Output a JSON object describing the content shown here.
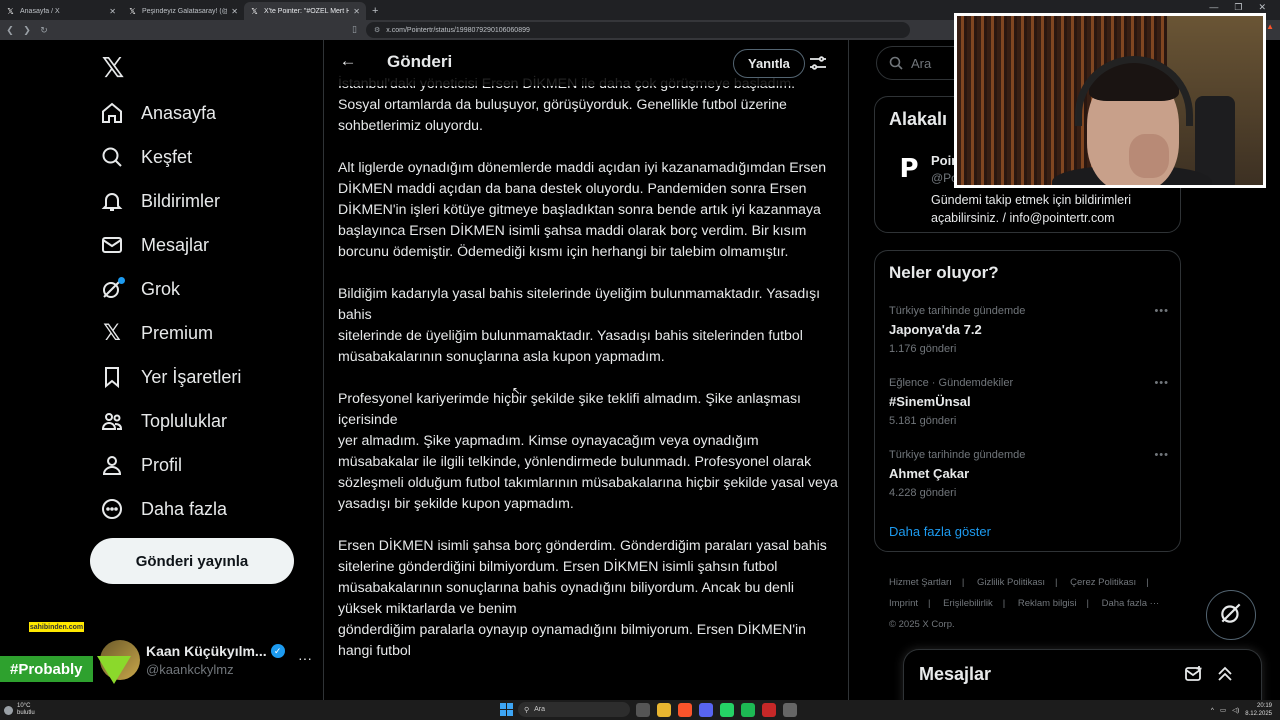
{
  "browser": {
    "tabs": [
      {
        "title": "Anasayfa / X",
        "active": false
      },
      {
        "title": "Peşindeyiz Galatasaray! (@Pesindey...",
        "active": false
      },
      {
        "title": "X'te Pointer: \"#ÖZEL Mert Hakan...",
        "active": true
      }
    ],
    "new_tab": "+",
    "url": "x.com/Pointertr/status/1998079290106060899",
    "window_controls": [
      "—",
      "❐",
      "✕"
    ]
  },
  "sidebar": {
    "logo": "𝕏",
    "items": [
      {
        "label": "Anasayfa",
        "icon": "home-icon"
      },
      {
        "label": "Keşfet",
        "icon": "search-icon"
      },
      {
        "label": "Bildirimler",
        "icon": "bell-icon"
      },
      {
        "label": "Mesajlar",
        "icon": "mail-icon"
      },
      {
        "label": "Grok",
        "icon": "grok-icon"
      },
      {
        "label": "Premium",
        "icon": "x-premium-icon"
      },
      {
        "label": "Yer İşaretleri",
        "icon": "bookmark-icon"
      },
      {
        "label": "Topluluklar",
        "icon": "communities-icon"
      },
      {
        "label": "Profil",
        "icon": "profile-icon"
      },
      {
        "label": "Daha fazla",
        "icon": "more-circle-icon"
      }
    ],
    "post_button": "Gönderi yayınla",
    "account": {
      "name": "Kaan Küçükyılm...",
      "handle": "@kaankckylmz",
      "more": "···"
    }
  },
  "overlays": {
    "sahibinden": "sahibinden.com",
    "probably": "#Probably"
  },
  "main": {
    "header_title": "Gönderi",
    "reply_button": "Yanıtla",
    "cut_line": "İstanbul'daki yöneticisi Ersen DİKMEN ile daha çok görüşmeye başladım.",
    "paragraphs": [
      "Sosyal ortamlarda da buluşuyor, görüşüyorduk. Genellikle futbol üzerine sohbetlerimiz oluyordu.",
      "Alt liglerde oynadığım dönemlerde maddi açıdan iyi kazanamadığımdan Ersen DİKMEN maddi açıdan da bana destek oluyordu. Pandemiden sonra Ersen DİKMEN'in işleri kötüye gitmeye başladıktan sonra bende artık iyi kazanmaya başlayınca Ersen DİKMEN isimli şahsa maddi olarak borç verdim. Bir kısım borcunu ödemiştir. Ödemediği kısmı için herhangi bir talebim olmamıştır.",
      "Bildiğim kadarıyla yasal bahis sitelerinde üyeliğim bulunmamaktadır. Yasadışı bahis\nsitelerinde de üyeliğim bulunmamaktadır. Yasadışı bahis sitelerinden futbol müsabakalarının sonuçlarına asla kupon yapmadım.",
      "Profesyonel kariyerimde hiçbir şekilde şike teklifi almadım. Şike anlaşması içerisinde\nyer almadım. Şike yapmadım. Kimse oynayacağım veya oynadığım müsabakalar ile ilgili telkinde, yönlendirmede bulunmadı. Profesyonel olarak sözleşmeli olduğum futbol takımlarının müsabakalarına hiçbir şekilde yasal veya yasadışı bir şekilde kupon yapmadım.",
      "Ersen DİKMEN isimli şahsa borç gönderdim. Gönderdiğim paraları yasal bahis\nsitelerine gönderdiğini bilmiyordum. Ersen DİKMEN isimli şahsın futbol müsabakalarının sonuçlarına bahis oynadığını biliyordum. Ancak bu denli yüksek miktarlarda ve benim\ngönderdiğim paralarla oynayıp oynamadığını bilmiyorum. Ersen DİKMEN'in hangi futbol"
    ]
  },
  "right": {
    "search_placeholder": "Ara",
    "related": {
      "title": "Alakalı",
      "name": "Poin",
      "handle": "@Po",
      "bio": "Gündemi takip etmek için bildirimleri açabilirsiniz. / info@pointertr.com"
    },
    "trending": {
      "title": "Neler oluyor?",
      "items": [
        {
          "context": "Türkiye tarihinde gündemde",
          "name": "Japonya'da 7.2",
          "count": "1.176 gönderi"
        },
        {
          "context": "Eğlence · Gündemdekiler",
          "name": "#SinemÜnsal",
          "count": "5.181 gönderi"
        },
        {
          "context": "Türkiye tarihinde gündemde",
          "name": "Ahmet Çakar",
          "count": "4.228 gönderi"
        }
      ],
      "show_more": "Daha fazla göster"
    },
    "footer": {
      "line1": [
        "Hizmet Şartları",
        "|",
        "Gizlilik Politikası",
        "|",
        "Çerez Politikası",
        "|"
      ],
      "line2": [
        "Imprint",
        "|",
        "Erişilebilirlik",
        "|",
        "Reklam bilgisi",
        "|",
        "Daha fazla ···"
      ],
      "copyright": "© 2025 X Corp."
    },
    "messages_title": "Mesajlar"
  },
  "taskbar": {
    "weather_temp": "10°C",
    "weather_desc": "bulutlu",
    "search": "Ara",
    "time": "20:19",
    "date": "8.12.2025"
  },
  "colors": {
    "accent": "#1d9bf0",
    "background": "#000000",
    "border": "#2f3336",
    "muted_text": "#71767b",
    "probably_green": "#2ea12e",
    "sahibinden_yellow": "#ffe800"
  }
}
